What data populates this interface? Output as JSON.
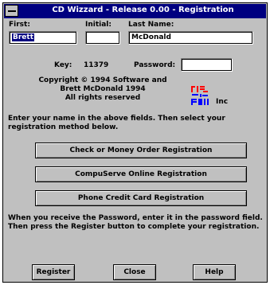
{
  "window": {
    "title": "CD Wizzard - Release 0.00 - Registration"
  },
  "form": {
    "first_label": "First:",
    "first_value": "Brett",
    "initial_label": "Initial:",
    "initial_value": "",
    "last_label": "Last Name:",
    "last_value": "McDonald",
    "key_label": "Key:",
    "key_value": "11379",
    "password_label": "Password:",
    "password_value": ""
  },
  "copyright": {
    "line1": "Copyright © 1994 Software and",
    "line2": "Brett McDonald 1994",
    "line3": "All rights reserved",
    "logo_suffix": "Inc"
  },
  "instructions": {
    "top": "Enter your name in the above fields. Then select your registration method below.",
    "bottom": "When you receive the Password, enter it in the password field. Then press the Register button to complete your registration."
  },
  "buttons": {
    "check": "Check or Money Order Registration",
    "compuserve": "CompuServe Online Registration",
    "phone": "Phone Credit Card Registration",
    "register": "Register",
    "close": "Close",
    "help": "Help"
  },
  "colors": {
    "titlebar": "#000080",
    "dialog": "#c0c0c0",
    "logo_red": "#ff0000",
    "logo_blue": "#0000ff"
  }
}
